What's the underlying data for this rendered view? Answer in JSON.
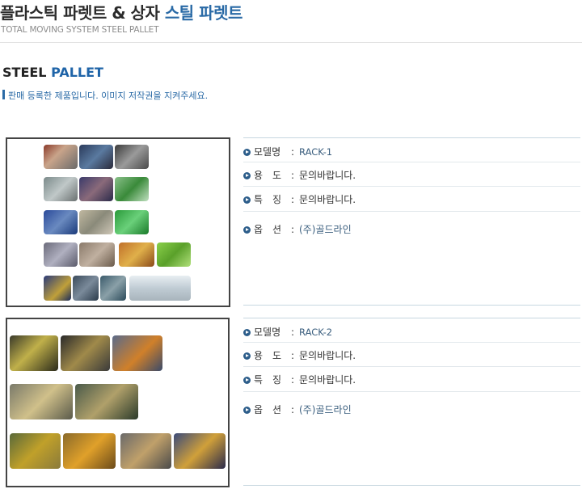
{
  "header": {
    "title_main": "플라스틱 파렛트 & 상자 ",
    "title_accent": "스틸 파렛트",
    "subtitle": "TOTAL MOVING SYSTEM STEEL PALLET"
  },
  "section": {
    "title_main": "STEEL ",
    "title_accent": "PALLET",
    "notice": "판매 등록한 제품입니다. 이미지 저작권을 지켜주세요."
  },
  "products": [
    {
      "model_label": "모델명",
      "model": "RACK-1",
      "use_label": "용　도",
      "use": "문의바랍니다.",
      "feature_label": "특　징",
      "feature": "문의바랍니다.",
      "option_label": "옵　션",
      "option": "(주)골드라인"
    },
    {
      "model_label": "모델명",
      "model": "RACK-2",
      "use_label": "용　도",
      "use": "문의바랍니다.",
      "feature_label": "특　징",
      "feature": "문의바랍니다.",
      "option_label": "옵　션",
      "option": "(주)골드라인"
    }
  ],
  "colors": {
    "accent": "#2a6aa6",
    "bullet": "#2c5d8a",
    "frame": "#444444"
  },
  "icons": {
    "bullet": "arrow-bullet-icon"
  }
}
